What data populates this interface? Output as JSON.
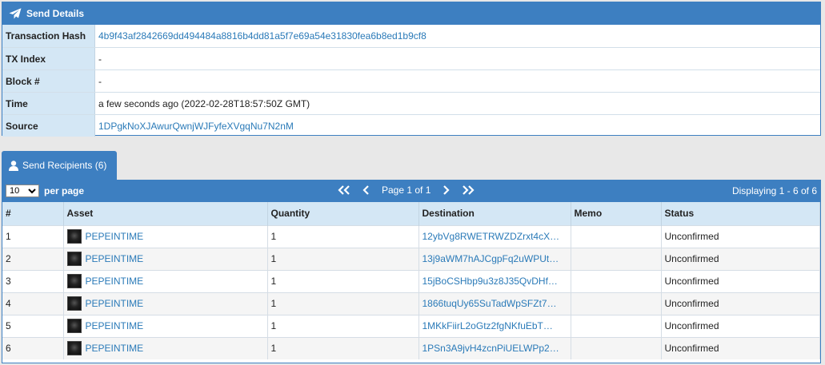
{
  "send_details": {
    "title": "Send Details",
    "rows": [
      {
        "label": "Transaction Hash",
        "value": "4b9f43af2842669dd494484a8816b4dd81a5f7e69a54e31830fea6b8ed1b9cf8",
        "link": true
      },
      {
        "label": "TX Index",
        "value": "-",
        "link": false
      },
      {
        "label": "Block #",
        "value": "-",
        "link": false
      },
      {
        "label": "Time",
        "value": "a few seconds ago (2022-02-28T18:57:50Z GMT)",
        "link": false
      },
      {
        "label": "Source",
        "value": "1DPgkNoXJAwurQwnjWJFyfeXVgqNu7N2nM",
        "link": true
      }
    ]
  },
  "recipients_tab": {
    "label": "Send Recipients (6)"
  },
  "toolbar": {
    "per_page_value": "10",
    "per_page_label": "per page",
    "page_text": "Page 1 of 1",
    "displaying": "Displaying 1 - 6 of 6"
  },
  "table": {
    "columns": [
      "#",
      "Asset",
      "Quantity",
      "Destination",
      "Memo",
      "Status"
    ],
    "rows": [
      {
        "n": "1",
        "asset": "PEPEINTIME",
        "qty": "1",
        "dest": "12ybVg8RWETRWZDZrxt4cX…",
        "memo": "",
        "status": "Unconfirmed"
      },
      {
        "n": "2",
        "asset": "PEPEINTIME",
        "qty": "1",
        "dest": "13j9aWM7hAJCgpFq2uWPUt…",
        "memo": "",
        "status": "Unconfirmed"
      },
      {
        "n": "3",
        "asset": "PEPEINTIME",
        "qty": "1",
        "dest": "15jBoCSHbp9u3z8J35QvDHf…",
        "memo": "",
        "status": "Unconfirmed"
      },
      {
        "n": "4",
        "asset": "PEPEINTIME",
        "qty": "1",
        "dest": "1866tuqUy65SuTadWpSFZt7…",
        "memo": "",
        "status": "Unconfirmed"
      },
      {
        "n": "5",
        "asset": "PEPEINTIME",
        "qty": "1",
        "dest": "1MKkFiirL2oGtz2fgNKfuEbT…",
        "memo": "",
        "status": "Unconfirmed"
      },
      {
        "n": "6",
        "asset": "PEPEINTIME",
        "qty": "1",
        "dest": "1PSn3A9jvH4zcnPiUELWPp2…",
        "memo": "",
        "status": "Unconfirmed"
      }
    ]
  },
  "colors": {
    "accent": "#3d7fc1",
    "label_bg": "#d4e7f5",
    "link": "#2a7ab8"
  }
}
